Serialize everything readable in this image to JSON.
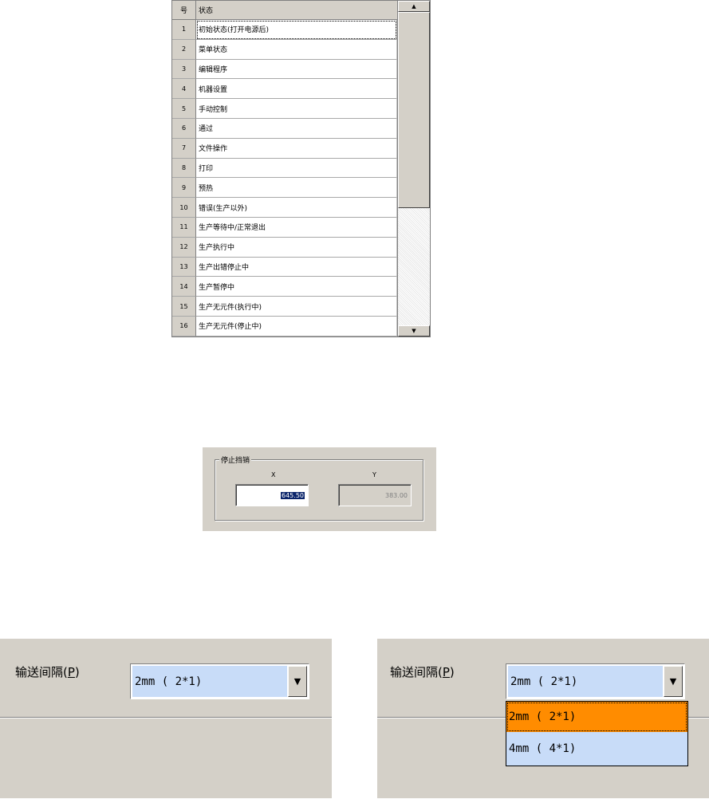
{
  "status_table": {
    "header_no": "号",
    "header_status": "状态",
    "rows": [
      {
        "no": "1",
        "status": "初始状态(打开电源后)"
      },
      {
        "no": "2",
        "status": "菜单状态"
      },
      {
        "no": "3",
        "status": "编辑程序"
      },
      {
        "no": "4",
        "status": "机器设置"
      },
      {
        "no": "5",
        "status": "手动控制"
      },
      {
        "no": "6",
        "status": "通过"
      },
      {
        "no": "7",
        "status": "文件操作"
      },
      {
        "no": "8",
        "status": "打印"
      },
      {
        "no": "9",
        "status": "预热"
      },
      {
        "no": "10",
        "status": "错误(生产以外)"
      },
      {
        "no": "11",
        "status": "生产等待中/正常退出"
      },
      {
        "no": "12",
        "status": "生产执行中"
      },
      {
        "no": "13",
        "status": "生产出错停止中"
      },
      {
        "no": "14",
        "status": "生产暂停中"
      },
      {
        "no": "15",
        "status": "生产无元件(执行中)"
      },
      {
        "no": "16",
        "status": "生产无元件(停止中)"
      }
    ],
    "scroll_up_glyph": "▲",
    "scroll_down_glyph": "▼"
  },
  "stop_group": {
    "legend": "停止挡销",
    "x_label": "X",
    "y_label": "Y",
    "x_value": "645.50",
    "y_value": "383.00"
  },
  "conveyor_left": {
    "label_prefix": "输送间隔",
    "label_hotkey": "P",
    "selected_value": "2mm ( 2*1)",
    "arrow_glyph": "▼"
  },
  "conveyor_right": {
    "label_prefix": "输送间隔",
    "label_hotkey": "P",
    "selected_value": "2mm ( 2*1)",
    "arrow_glyph": "▼",
    "options": [
      "2mm ( 2*1)",
      "4mm ( 4*1)"
    ]
  },
  "colors": {
    "dialog_face": "#d4d0c8",
    "selection_highlight": "#0a246a",
    "combo_field": "#c8dcf8",
    "dropdown_selected": "#ff8c00"
  }
}
